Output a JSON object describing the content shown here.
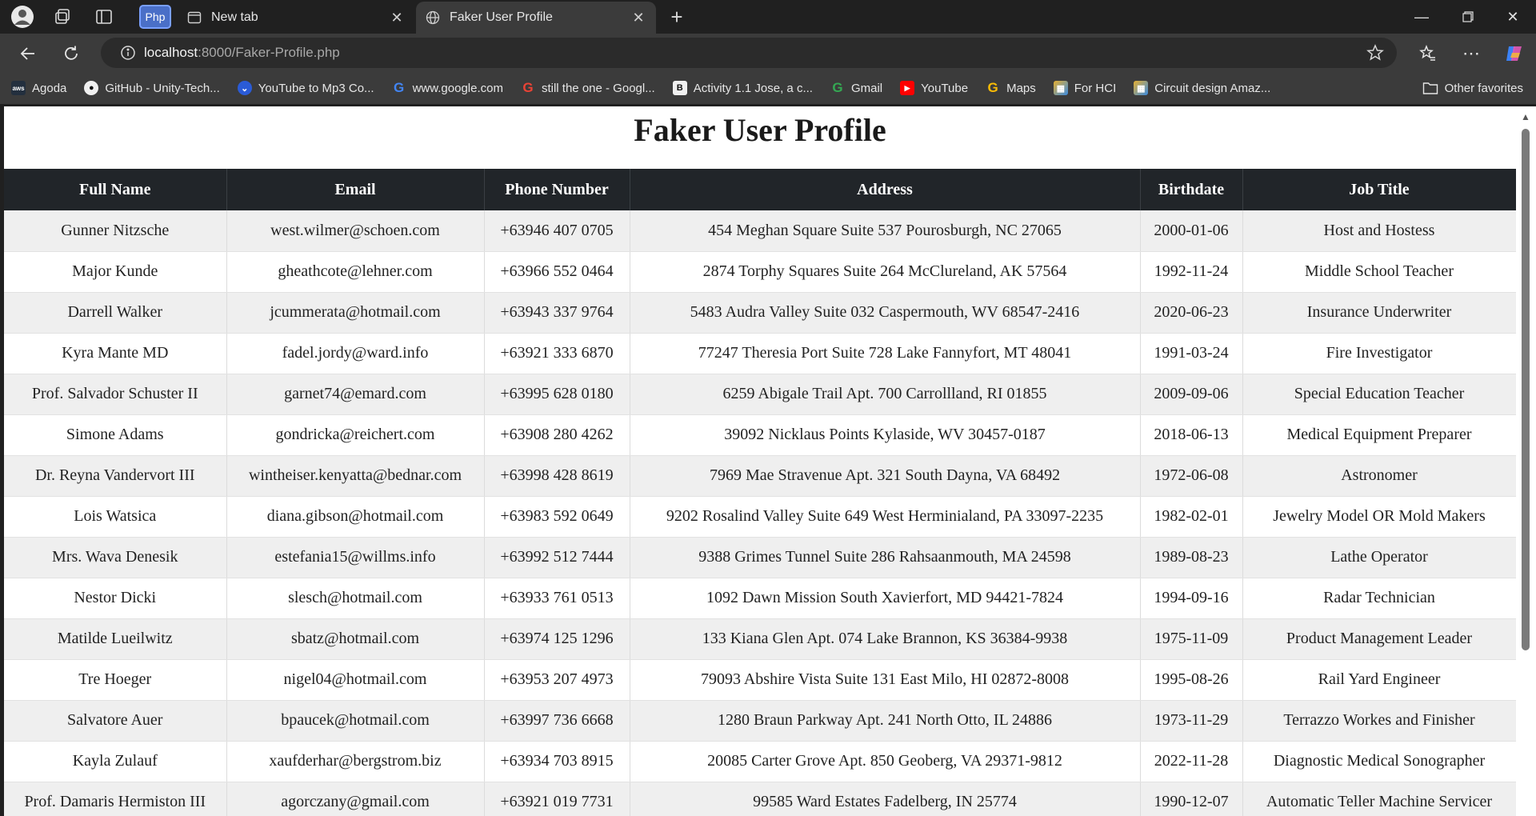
{
  "browser": {
    "tabs": [
      {
        "title": "New tab"
      },
      {
        "title": "Faker User Profile"
      }
    ],
    "php_badge": "Php",
    "url_host": "localhost",
    "url_path": ":8000/Faker-Profile.php",
    "bookmarks": [
      {
        "label": "Agoda",
        "icon": "aws-icon"
      },
      {
        "label": "GitHub - Unity-Tech...",
        "icon": "github-icon"
      },
      {
        "label": "YouTube to Mp3 Co...",
        "icon": "download-icon"
      },
      {
        "label": "www.google.com",
        "icon": "google-icon"
      },
      {
        "label": "still the one - Googl...",
        "icon": "google-icon"
      },
      {
        "label": "Activity 1.1 Jose, a c...",
        "icon": "b-icon"
      },
      {
        "label": "Gmail",
        "icon": "google-icon"
      },
      {
        "label": "YouTube",
        "icon": "youtube-icon"
      },
      {
        "label": "Maps",
        "icon": "google-icon"
      },
      {
        "label": "For HCI",
        "icon": "grid-icon"
      },
      {
        "label": "Circuit design Amaz...",
        "icon": "grid-icon"
      }
    ],
    "other_favorites": "Other favorites"
  },
  "page": {
    "title": "Faker User Profile",
    "columns": [
      "Full Name",
      "Email",
      "Phone Number",
      "Address",
      "Birthdate",
      "Job Title"
    ],
    "rows": [
      [
        "Gunner Nitzsche",
        "west.wilmer@schoen.com",
        "+63946 407 0705",
        "454 Meghan Square Suite 537 Pourosburgh, NC 27065",
        "2000-01-06",
        "Host and Hostess"
      ],
      [
        "Major Kunde",
        "gheathcote@lehner.com",
        "+63966 552 0464",
        "2874 Torphy Squares Suite 264 McClureland, AK 57564",
        "1992-11-24",
        "Middle School Teacher"
      ],
      [
        "Darrell Walker",
        "jcummerata@hotmail.com",
        "+63943 337 9764",
        "5483 Audra Valley Suite 032 Caspermouth, WV 68547-2416",
        "2020-06-23",
        "Insurance Underwriter"
      ],
      [
        "Kyra Mante MD",
        "fadel.jordy@ward.info",
        "+63921 333 6870",
        "77247 Theresia Port Suite 728 Lake Fannyfort, MT 48041",
        "1991-03-24",
        "Fire Investigator"
      ],
      [
        "Prof. Salvador Schuster II",
        "garnet74@emard.com",
        "+63995 628 0180",
        "6259 Abigale Trail Apt. 700 Carrollland, RI 01855",
        "2009-09-06",
        "Special Education Teacher"
      ],
      [
        "Simone Adams",
        "gondricka@reichert.com",
        "+63908 280 4262",
        "39092 Nicklaus Points Kylaside, WV 30457-0187",
        "2018-06-13",
        "Medical Equipment Preparer"
      ],
      [
        "Dr. Reyna Vandervort III",
        "wintheiser.kenyatta@bednar.com",
        "+63998 428 8619",
        "7969 Mae Stravenue Apt. 321 South Dayna, VA 68492",
        "1972-06-08",
        "Astronomer"
      ],
      [
        "Lois Watsica",
        "diana.gibson@hotmail.com",
        "+63983 592 0649",
        "9202 Rosalind Valley Suite 649 West Herminialand, PA 33097-2235",
        "1982-02-01",
        "Jewelry Model OR Mold Makers"
      ],
      [
        "Mrs. Wava Denesik",
        "estefania15@willms.info",
        "+63992 512 7444",
        "9388 Grimes Tunnel Suite 286 Rahsaanmouth, MA 24598",
        "1989-08-23",
        "Lathe Operator"
      ],
      [
        "Nestor Dicki",
        "slesch@hotmail.com",
        "+63933 761 0513",
        "1092 Dawn Mission South Xavierfort, MD 94421-7824",
        "1994-09-16",
        "Radar Technician"
      ],
      [
        "Matilde Lueilwitz",
        "sbatz@hotmail.com",
        "+63974 125 1296",
        "133 Kiana Glen Apt. 074 Lake Brannon, KS 36384-9938",
        "1975-11-09",
        "Product Management Leader"
      ],
      [
        "Tre Hoeger",
        "nigel04@hotmail.com",
        "+63953 207 4973",
        "79093 Abshire Vista Suite 131 East Milo, HI 02872-8008",
        "1995-08-26",
        "Rail Yard Engineer"
      ],
      [
        "Salvatore Auer",
        "bpaucek@hotmail.com",
        "+63997 736 6668",
        "1280 Braun Parkway Apt. 241 North Otto, IL 24886",
        "1973-11-29",
        "Terrazzo Workes and Finisher"
      ],
      [
        "Kayla Zulauf",
        "xaufderhar@bergstrom.biz",
        "+63934 703 8915",
        "20085 Carter Grove Apt. 850 Geoberg, VA 29371-9812",
        "2022-11-28",
        "Diagnostic Medical Sonographer"
      ],
      [
        "Prof. Damaris Hermiston III",
        "agorczany@gmail.com",
        "+63921 019 7731",
        "99585 Ward Estates Fadelberg, IN 25774",
        "1990-12-07",
        "Automatic Teller Machine Servicer"
      ]
    ]
  }
}
